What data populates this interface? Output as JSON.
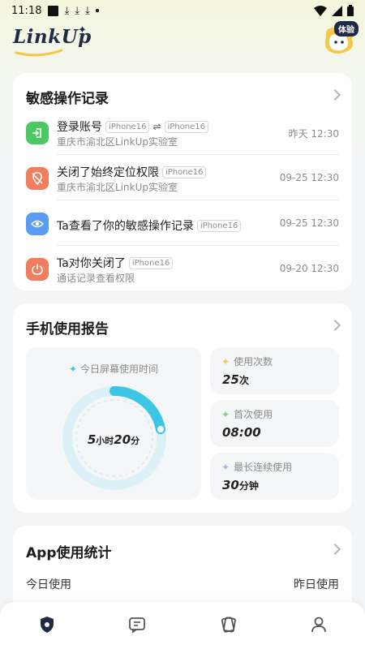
{
  "status_bar": {
    "time": "11:18"
  },
  "header": {
    "logo_text": "LinkUp",
    "trial_badge": "体验"
  },
  "sensitive": {
    "title": "敏感操作记录",
    "items": [
      {
        "title": "登录账号",
        "tags": [
          "iPhone16",
          "iPhone16"
        ],
        "subtitle": "重庆市渝北区LinkUp实验室",
        "time": "昨天 12:30",
        "icon": "login-icon",
        "color": "#4cc764"
      },
      {
        "title": "关闭了始终定位权限",
        "tags": [
          "iPhone16"
        ],
        "subtitle": "重庆市渝北区LinkUp实验室",
        "time": "09-25 12:30",
        "icon": "location-off-icon",
        "color": "#f07e5e"
      },
      {
        "title": "Ta查看了你的敏感操作记录",
        "tags": [
          "iPhone16"
        ],
        "subtitle": "",
        "time": "09-25 12:30",
        "icon": "eye-icon",
        "color": "#5b9cf2"
      },
      {
        "title": "Ta对你关闭了",
        "tags": [
          "iPhone16"
        ],
        "subtitle": "通话记录查看权限",
        "time": "09-20 12:30",
        "icon": "power-icon",
        "color": "#f07e5e"
      }
    ]
  },
  "phone_usage": {
    "title": "手机使用报告",
    "screen_time": {
      "label": "今日屏幕使用时间",
      "hours": "5",
      "hours_unit": "小时",
      "minutes": "20",
      "minutes_unit": "分",
      "progress": 0.22
    },
    "tiles": [
      {
        "label": "使用次数",
        "value": "25",
        "unit": "次",
        "star_color": "#f5c74a"
      },
      {
        "label": "首次使用",
        "value": "08:00",
        "unit": "",
        "star_color": "#7ad67e"
      },
      {
        "label": "最长连续使用",
        "value": "30",
        "unit": "分钟",
        "star_color": "#aab5ee"
      }
    ]
  },
  "app_stats": {
    "title": "App使用统计",
    "today_label": "今日使用",
    "yesterday_label": "昨日使用"
  },
  "colors": {
    "accent": "#3bc6e6",
    "ring_bg": "#dcf1f7"
  }
}
